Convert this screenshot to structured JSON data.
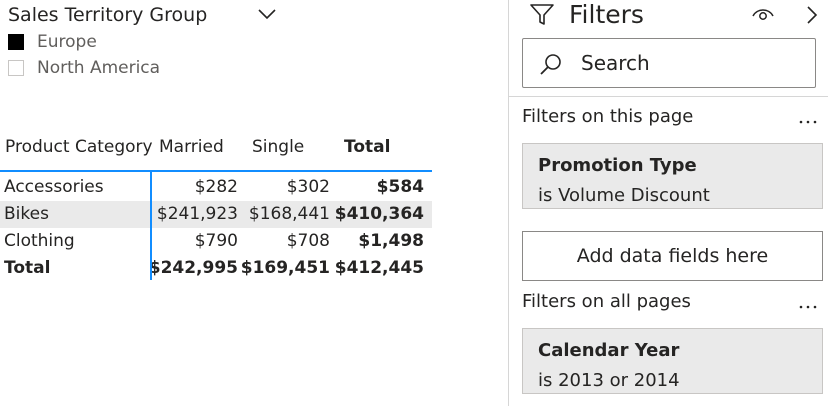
{
  "slicer": {
    "title": "Sales Territory Group",
    "items": [
      {
        "label": "Europe",
        "checked": true
      },
      {
        "label": "North America",
        "checked": false
      }
    ]
  },
  "matrix": {
    "headers": [
      "Product Category",
      "Married",
      "Single",
      "Total"
    ],
    "rows": [
      [
        "Accessories",
        "$282",
        "$302",
        "$584"
      ],
      [
        "Bikes",
        "$241,923",
        "$168,441",
        "$410,364"
      ],
      [
        "Clothing",
        "$790",
        "$708",
        "$1,498"
      ]
    ],
    "total": [
      "Total",
      "$242,995",
      "$169,451",
      "$412,445"
    ]
  },
  "filters_pane": {
    "title": "Filters",
    "search_placeholder": "Search",
    "page_section": "Filters on this page",
    "page_filter": {
      "title": "Promotion Type",
      "value": "is Volume Discount"
    },
    "add_fields": "Add data fields here",
    "all_section": "Filters on all pages",
    "all_filter": {
      "title": "Calendar Year",
      "value": "is 2013 or 2014"
    }
  },
  "icons": {
    "chevron": "chevron-down-icon",
    "filter": "filter-icon",
    "eye": "eye-icon",
    "collapse": "chevron-right-icon",
    "search": "search-icon",
    "more": "more-options-icon"
  },
  "colors": {
    "accent": "#118dff",
    "row_stripe": "#eaeaea",
    "card_bg": "#eaeaea",
    "text": "#252423",
    "muted_text": "#605e5c"
  }
}
